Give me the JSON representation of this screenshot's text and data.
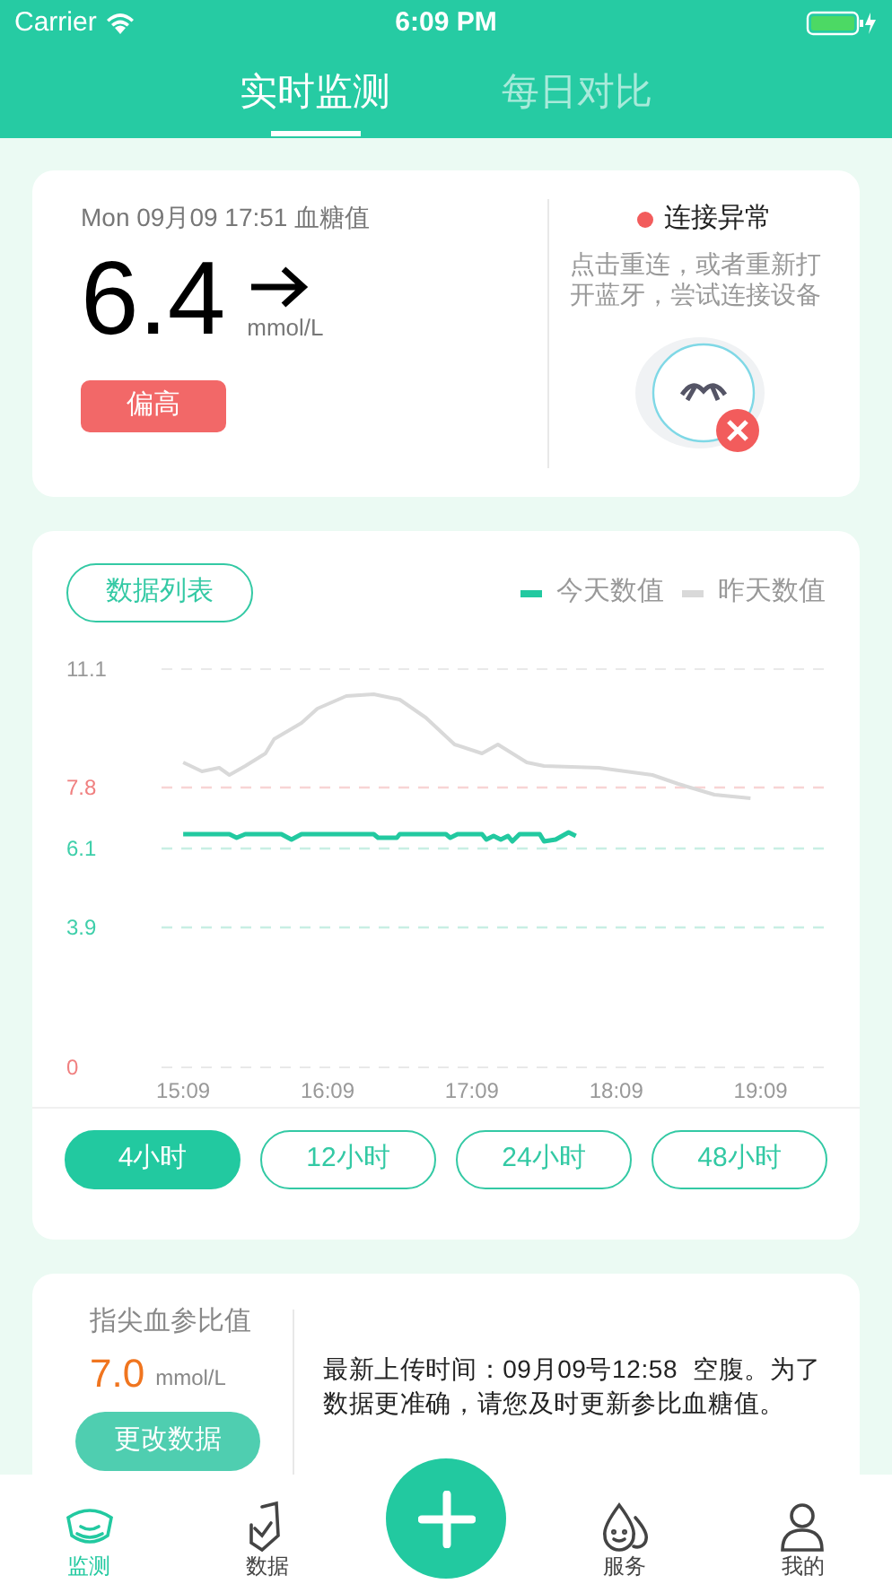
{
  "status_bar": {
    "carrier": "Carrier",
    "time": "6:09 PM"
  },
  "tabs": [
    {
      "label": "实时监测",
      "selected": true
    },
    {
      "label": "每日对比",
      "selected": false
    }
  ],
  "reading_card": {
    "timestamp": "Mon 09月09 17:51 血糖值",
    "value": "6.4",
    "unit": "mmol/L",
    "status_badge": "偏高",
    "connection_status": "连接异常",
    "connection_hint": "点击重连，或者重新打开蓝牙，尝试连接设备"
  },
  "chart_card": {
    "list_button": "数据列表",
    "chart_data": {
      "type": "line",
      "ylim": [
        0,
        11.1
      ],
      "yticks": [
        0,
        3.9,
        6.1,
        7.8,
        11.1
      ],
      "xlim": [
        15.0,
        19.6
      ],
      "ref_lines": [
        {
          "axis": "y",
          "value": 3.9,
          "color": "#c8efe4"
        },
        {
          "axis": "y",
          "value": 6.1,
          "color": "#c8efe4"
        },
        {
          "axis": "y",
          "value": 7.8,
          "color": "#f8d4d4"
        }
      ],
      "xticks": [
        {
          "value": 15.15,
          "label": "15:09"
        },
        {
          "value": 16.15,
          "label": "16:09"
        },
        {
          "value": 17.15,
          "label": "17:09"
        },
        {
          "value": 18.15,
          "label": "18:09"
        },
        {
          "value": 19.15,
          "label": "19:09"
        }
      ],
      "series": [
        {
          "name": "今天数值",
          "color": "#22c9a0",
          "x": [
            15.15,
            15.47,
            15.52,
            15.58,
            15.83,
            15.9,
            15.97,
            16.47,
            16.5,
            16.63,
            16.65,
            16.97,
            17.0,
            17.05,
            17.22,
            17.25,
            17.3,
            17.35,
            17.4,
            17.43,
            17.48,
            17.62,
            17.65,
            17.73,
            17.82,
            17.87
          ],
          "values": [
            6.5,
            6.5,
            6.4,
            6.5,
            6.5,
            6.35,
            6.5,
            6.5,
            6.4,
            6.4,
            6.5,
            6.5,
            6.4,
            6.5,
            6.5,
            6.35,
            6.45,
            6.35,
            6.45,
            6.3,
            6.5,
            6.5,
            6.3,
            6.35,
            6.55,
            6.45
          ]
        },
        {
          "name": "昨天数值",
          "color": "#d9d9d9",
          "x": [
            15.15,
            15.28,
            15.4,
            15.47,
            15.58,
            15.72,
            15.78,
            15.97,
            16.08,
            16.28,
            16.47,
            16.65,
            16.83,
            17.03,
            17.22,
            17.33,
            17.53,
            17.65,
            18.03,
            18.4,
            18.58,
            18.83,
            19.08
          ],
          "values": [
            8.5,
            8.25,
            8.35,
            8.15,
            8.4,
            8.75,
            9.15,
            9.6,
            10.0,
            10.35,
            10.4,
            10.25,
            9.75,
            9.0,
            8.75,
            9.0,
            8.5,
            8.4,
            8.35,
            8.15,
            7.9,
            7.6,
            7.5
          ]
        }
      ]
    },
    "periods": [
      {
        "label": "4小时",
        "selected": true
      },
      {
        "label": "12小时",
        "selected": false
      },
      {
        "label": "24小时",
        "selected": false
      },
      {
        "label": "48小时",
        "selected": false
      }
    ]
  },
  "reference_card": {
    "label": "指尖血参比值",
    "value": "7.0",
    "unit": "mmol/L",
    "button": "更改数据",
    "message": "最新上传时间：09月09号12:58  空腹。为了数据更准确，请您及时更新参比血糖值。"
  },
  "bottom_nav": [
    {
      "kind": "tab",
      "label": "监测",
      "selected": true
    },
    {
      "kind": "tab",
      "label": "数据",
      "selected": false
    },
    {
      "kind": "add"
    },
    {
      "kind": "tab",
      "label": "服务",
      "selected": false
    },
    {
      "kind": "tab",
      "label": "我的",
      "selected": false
    }
  ]
}
